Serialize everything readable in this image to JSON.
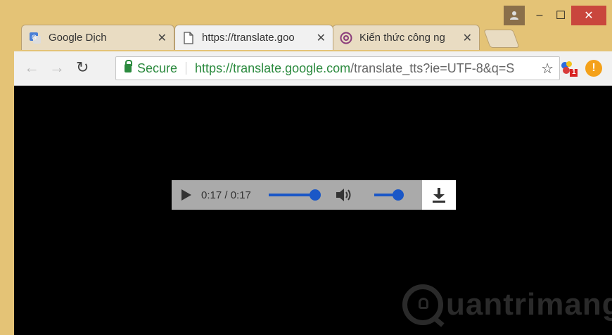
{
  "window": {
    "buttons": {
      "minimize": "–",
      "maximize": "☐",
      "close": "✕"
    }
  },
  "tabs": [
    {
      "title": "Google Dịch",
      "icon": "google-translate-icon"
    },
    {
      "title": "https://translate.goo",
      "icon": "document-icon",
      "active": true
    },
    {
      "title": "Kiến thức công ng",
      "icon": "at-sign-icon"
    }
  ],
  "toolbar": {
    "secure_label": "Secure",
    "url_host": "https://translate.google.com",
    "url_path": "/translate_tts?ie=UTF-8&q=S",
    "extension_badge": "1",
    "alert_glyph": "!"
  },
  "player": {
    "time": "0:17 / 0:17",
    "progress": 1.0,
    "volume": 1.0,
    "accent": "#1a57c7"
  },
  "watermark": {
    "text": "uantrimang"
  }
}
